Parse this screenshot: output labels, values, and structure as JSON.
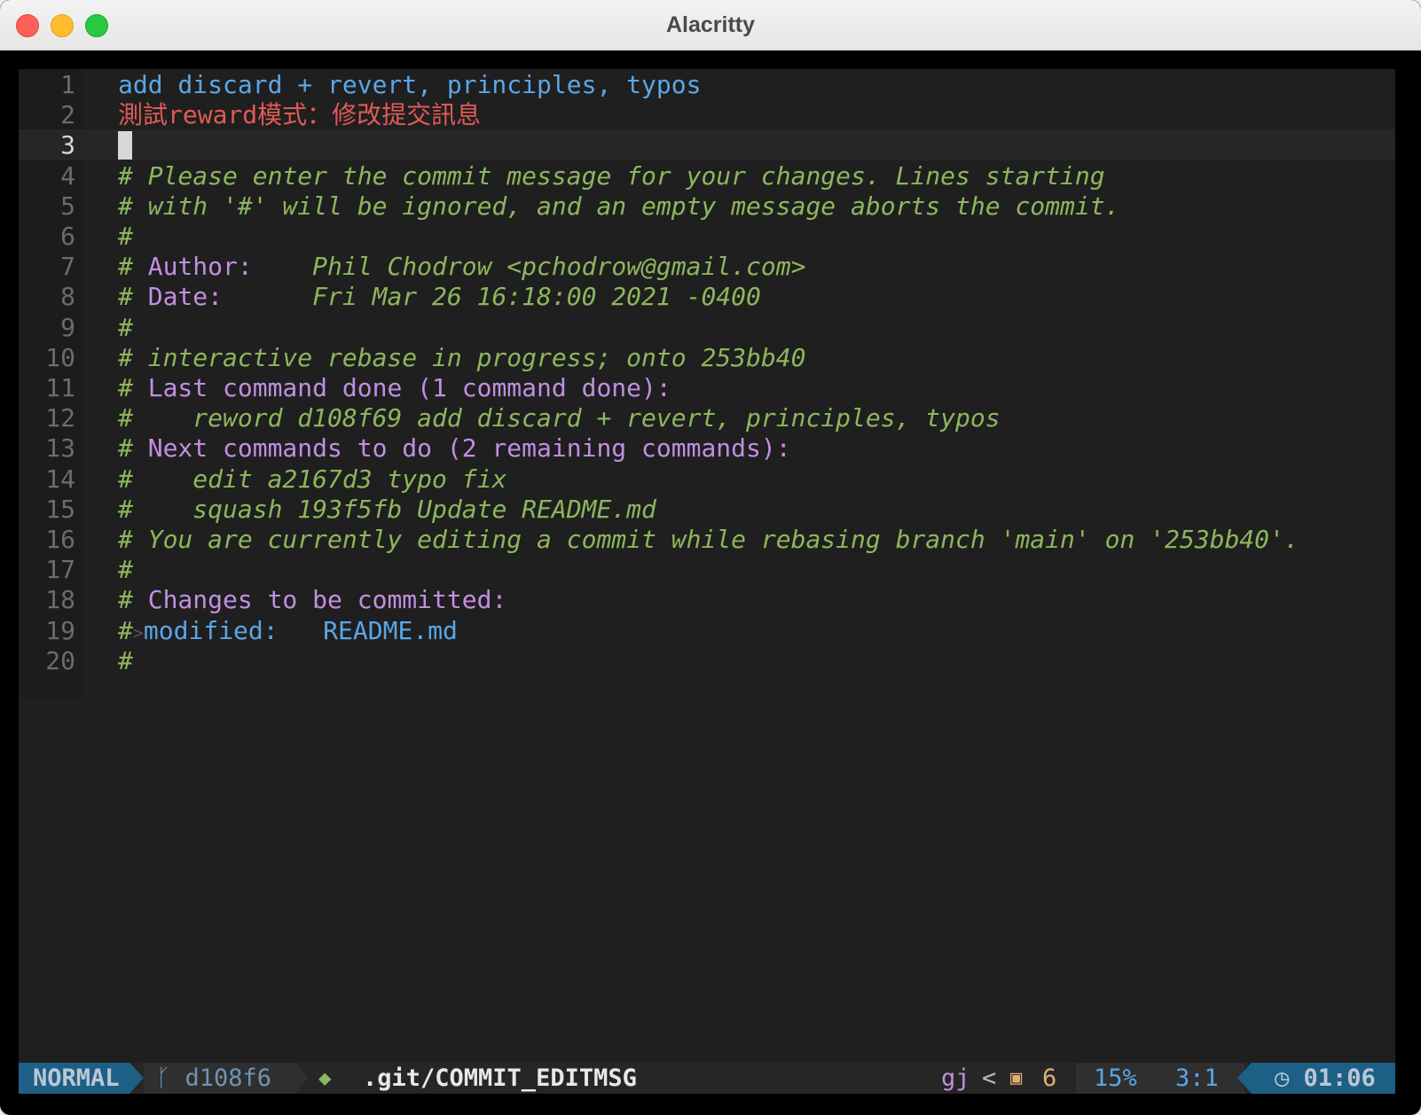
{
  "window": {
    "title": "Alacritty"
  },
  "editor": {
    "cursor_line": 3,
    "lines": [
      {
        "n": "1",
        "segs": [
          {
            "c": "blue",
            "t": "add discard + revert, principles, typos"
          }
        ]
      },
      {
        "n": "2",
        "segs": [
          {
            "c": "red",
            "t": "測試reward模式：修改提交訊息"
          }
        ]
      },
      {
        "n": "3",
        "segs": []
      },
      {
        "n": "4",
        "segs": [
          {
            "c": "green",
            "t": "# Please enter the commit message for your changes. Lines starting"
          }
        ]
      },
      {
        "n": "5",
        "segs": [
          {
            "c": "green",
            "t": "# with '#' will be ignored, and an empty message aborts the commit."
          }
        ]
      },
      {
        "n": "6",
        "segs": [
          {
            "c": "hash",
            "t": "#"
          }
        ]
      },
      {
        "n": "7",
        "segs": [
          {
            "c": "hash",
            "t": "# "
          },
          {
            "c": "purple",
            "t": "Author:"
          },
          {
            "c": "green",
            "t": "    Phil Chodrow <pchodrow@gmail.com>"
          }
        ]
      },
      {
        "n": "8",
        "segs": [
          {
            "c": "hash",
            "t": "# "
          },
          {
            "c": "purple",
            "t": "Date:"
          },
          {
            "c": "green",
            "t": "      Fri Mar 26 16:18:00 2021 -0400"
          }
        ]
      },
      {
        "n": "9",
        "segs": [
          {
            "c": "hash",
            "t": "#"
          }
        ]
      },
      {
        "n": "10",
        "segs": [
          {
            "c": "green",
            "t": "# interactive rebase in progress; onto 253bb40"
          }
        ]
      },
      {
        "n": "11",
        "segs": [
          {
            "c": "hash",
            "t": "# "
          },
          {
            "c": "purple",
            "t": "Last command done (1 command done):"
          }
        ]
      },
      {
        "n": "12",
        "segs": [
          {
            "c": "hash",
            "t": "#"
          },
          {
            "c": "green",
            "t": "    reword d108f69 add discard + revert, principles, typos"
          }
        ]
      },
      {
        "n": "13",
        "segs": [
          {
            "c": "hash",
            "t": "# "
          },
          {
            "c": "purple",
            "t": "Next commands to do (2 remaining commands):"
          }
        ]
      },
      {
        "n": "14",
        "segs": [
          {
            "c": "hash",
            "t": "#"
          },
          {
            "c": "green",
            "t": "    edit a2167d3 typo fix"
          }
        ]
      },
      {
        "n": "15",
        "segs": [
          {
            "c": "hash",
            "t": "#"
          },
          {
            "c": "green",
            "t": "    squash 193f5fb Update README.md"
          }
        ]
      },
      {
        "n": "16",
        "segs": [
          {
            "c": "green",
            "t": "# You are currently editing a commit while rebasing branch 'main' on '253bb40'."
          }
        ]
      },
      {
        "n": "17",
        "segs": [
          {
            "c": "hash",
            "t": "#"
          }
        ]
      },
      {
        "n": "18",
        "segs": [
          {
            "c": "hash",
            "t": "# "
          },
          {
            "c": "purple",
            "t": "Changes to be committed:"
          }
        ]
      },
      {
        "n": "19",
        "segs": [
          {
            "c": "hash",
            "t": "#"
          },
          {
            "c": "arrow-ch",
            "t": ">"
          },
          {
            "c": "blue",
            "t": "modified:   README.md"
          }
        ]
      },
      {
        "n": "20",
        "segs": [
          {
            "c": "hash",
            "t": "#"
          }
        ]
      }
    ]
  },
  "statusline": {
    "mode": "NORMAL",
    "branch_icon": "git-branch-icon",
    "branch": "d108f6",
    "file_icon": "git-diff-icon",
    "filename": ".git/COMMIT_EDITMSG",
    "macro": "gj",
    "separator": "<",
    "package_icon": "package-icon",
    "count": "6",
    "percent": "15%",
    "position": "3:1",
    "clock_icon": "clock-icon",
    "time": "01:06"
  }
}
